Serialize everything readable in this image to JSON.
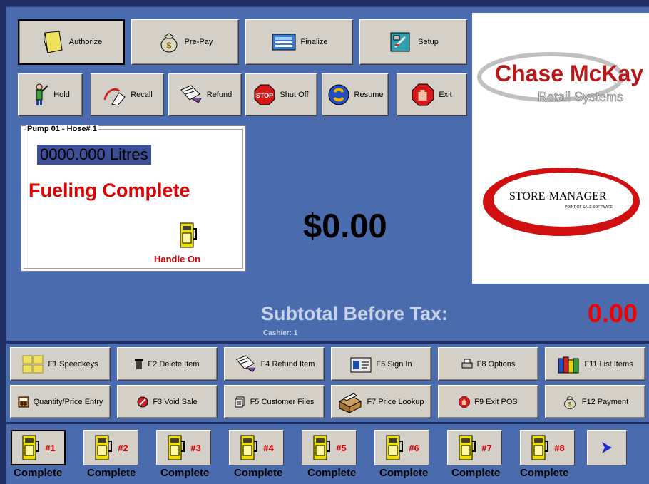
{
  "top_buttons": {
    "authorize": "Authorize",
    "prepay": "Pre-Pay",
    "finalize": "Finalize",
    "setup": "Setup",
    "hold": "Hold",
    "recall": "Recall",
    "refund": "Refund",
    "shutoff": "Shut Off",
    "resume": "Resume",
    "exit": "Exit"
  },
  "pump_panel": {
    "legend": "Pump 01 - Hose# 1",
    "litres": "0000.000 Litres",
    "status": "Fueling Complete",
    "handle": "Handle On"
  },
  "amount": "$0.00",
  "logos": {
    "chase_title": "Chase McKay",
    "chase_sub": "Retail Systems",
    "store_title": "STORE-MANAGER",
    "store_sub": "POINT OF SALE SOFTWARE"
  },
  "subtotal": {
    "label": "Subtotal Before Tax:",
    "value": "0.00",
    "cashier": "Cashier:  1"
  },
  "function_keys": {
    "f1": "F1 Speedkeys",
    "f2": "F2 Delete Item",
    "f4": "F4 Refund Item",
    "f6": "F6 Sign In",
    "f8": "F8 Options",
    "f11": "F11 List Items",
    "qty": "Quantity/Price Entry",
    "f3": "F3 Void Sale",
    "f5": "F5 Customer Files",
    "f7": "F7 Price Lookup",
    "f9": "F9 Exit POS",
    "f12": "F12 Payment"
  },
  "pumps": [
    {
      "num": "#1",
      "status": "Complete"
    },
    {
      "num": "#2",
      "status": "Complete"
    },
    {
      "num": "#3",
      "status": "Complete"
    },
    {
      "num": "#4",
      "status": "Complete"
    },
    {
      "num": "#5",
      "status": "Complete"
    },
    {
      "num": "#6",
      "status": "Complete"
    },
    {
      "num": "#7",
      "status": "Complete"
    },
    {
      "num": "#8",
      "status": "Complete"
    }
  ],
  "colors": {
    "panel_blue": "#4a6cae",
    "dark_blue": "#1e2f66",
    "status_red": "#e00000",
    "button_face": "#d4d0c8"
  }
}
